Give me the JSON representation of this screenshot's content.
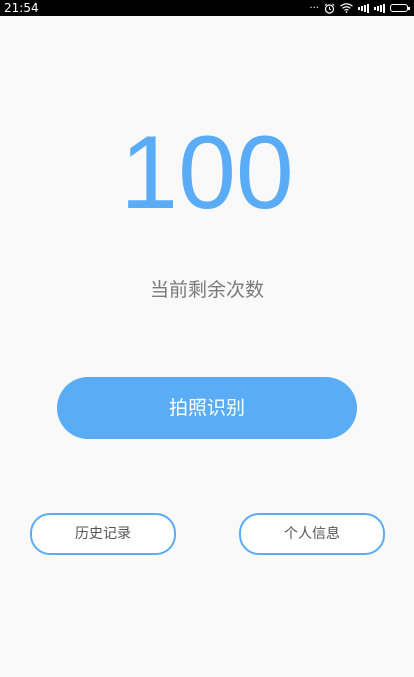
{
  "status_bar": {
    "time": "21:54",
    "icons": [
      "more-dots-icon",
      "alarm-icon",
      "wifi-icon",
      "signal-icon",
      "signal-icon",
      "battery-icon"
    ],
    "more_dots": "..."
  },
  "main": {
    "remaining_count": "100",
    "remaining_label": "当前剩余次数",
    "primary_action": "拍照识别",
    "history_button": "历史记录",
    "profile_button": "个人信息"
  },
  "colors": {
    "accent": "#5aacf7",
    "background": "#f9f9fa",
    "label_text": "#7a7a7a"
  }
}
